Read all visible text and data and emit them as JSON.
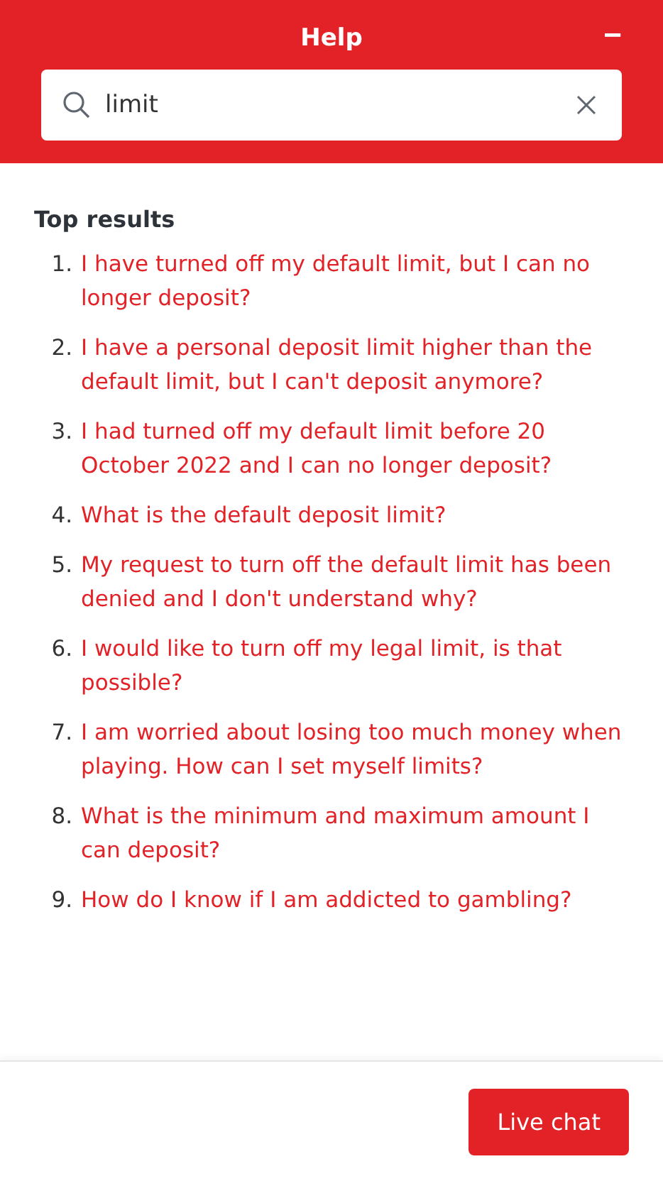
{
  "header": {
    "title": "Help",
    "minimize_icon": "−"
  },
  "search": {
    "value": "limit"
  },
  "results": {
    "heading": "Top results",
    "items": [
      {
        "number": "1.",
        "text": "I have turned off my default limit, but I can no longer deposit?"
      },
      {
        "number": "2.",
        "text": "I have a personal deposit limit higher than the default limit, but I can't deposit anymore?"
      },
      {
        "number": "3.",
        "text": "I had turned off my default limit before 20 October 2022 and I can no longer deposit?"
      },
      {
        "number": "4.",
        "text": "What is the default deposit limit?"
      },
      {
        "number": "5.",
        "text": "My request to turn off the default limit has been denied and I don't understand why?"
      },
      {
        "number": "6.",
        "text": "I would like to turn off my legal limit, is that possible?"
      },
      {
        "number": "7.",
        "text": "I am worried about losing too much money when playing. How can I set myself limits?"
      },
      {
        "number": "8.",
        "text": "What is the minimum and maximum amount I can deposit?"
      },
      {
        "number": "9.",
        "text": "How do I know if I am addicted to gambling?"
      }
    ]
  },
  "footer": {
    "button": "Live chat"
  }
}
